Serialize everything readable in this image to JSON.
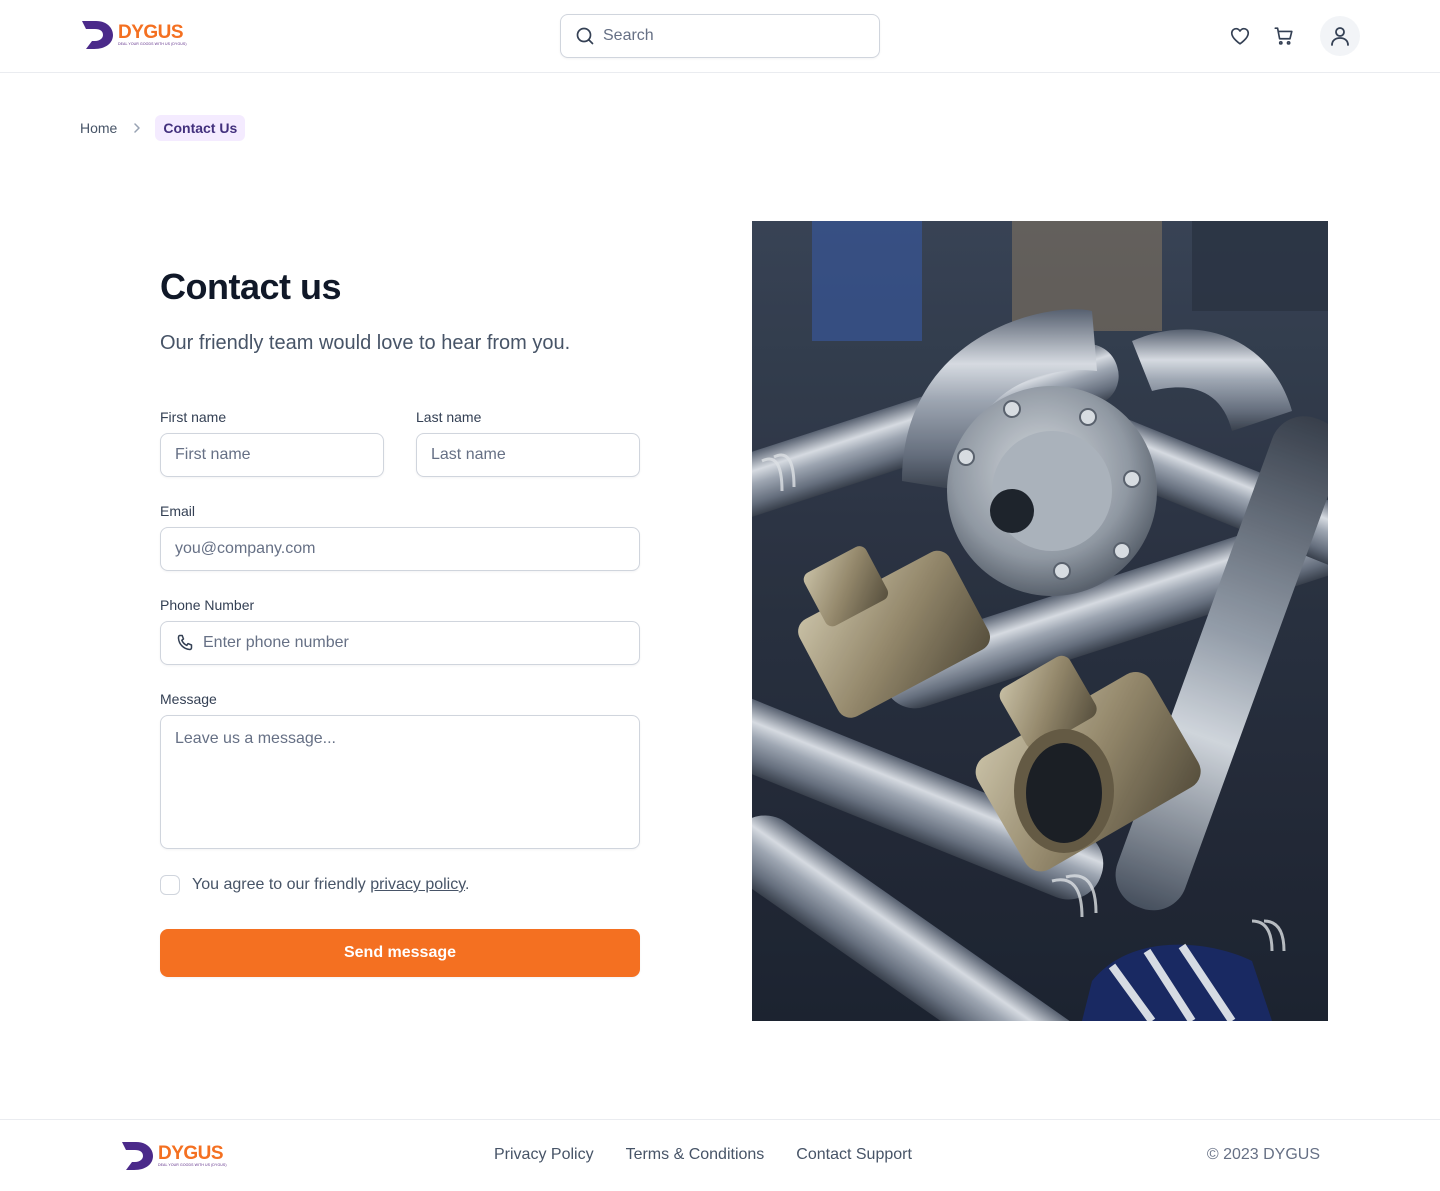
{
  "header": {
    "brand": "DYGUS",
    "tagline": "DEAL YOUR GOODS WITH US (DYGUS)",
    "search_placeholder": "Search",
    "icons": [
      "heart-icon",
      "cart-icon",
      "user-icon"
    ]
  },
  "breadcrumb": {
    "home": "Home",
    "current": "Contact Us"
  },
  "form": {
    "title": "Contact us",
    "subtitle": "Our friendly team would love to hear from you.",
    "first_name_label": "First name",
    "first_name_placeholder": "First name",
    "last_name_label": "Last name",
    "last_name_placeholder": "Last name",
    "email_label": "Email",
    "email_placeholder": "you@company.com",
    "phone_label": "Phone Number",
    "phone_placeholder": "Enter phone number",
    "message_label": "Message",
    "message_placeholder": "Leave us a message...",
    "agree_prefix": "You agree to our friendly ",
    "agree_link": "privacy policy",
    "agree_suffix": ".",
    "submit_label": "Send message"
  },
  "footer": {
    "brand": "DYGUS",
    "tagline": "DEAL YOUR GOODS WITH US (DYGUS)",
    "links": [
      "Privacy Policy",
      "Terms & Conditions",
      "Contact Support"
    ],
    "copyright": "© 2023 DYGUS"
  },
  "colors": {
    "accent": "#f47021",
    "brand_purple": "#4b2a8a",
    "breadcrumb_bg": "#f4ebff"
  }
}
